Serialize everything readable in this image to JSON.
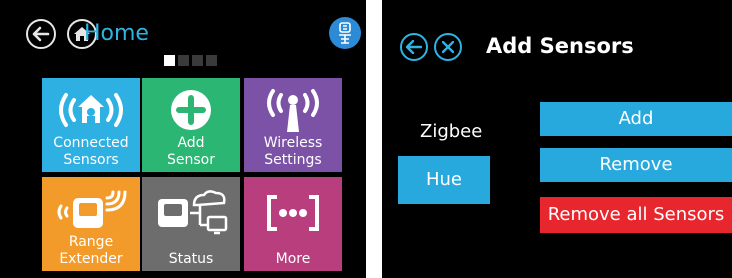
{
  "left": {
    "header": {
      "title": "Home"
    },
    "pager": {
      "pages": 4,
      "current": 1
    },
    "tiles": [
      {
        "line1": "Connected",
        "line2": "Sensors",
        "color": "#2fb0e3",
        "icon": "connected-sensors-icon"
      },
      {
        "line1": "Add",
        "line2": "Sensor",
        "color": "#2bb673",
        "icon": "add-icon"
      },
      {
        "line1": "Wireless",
        "line2": "Settings",
        "color": "#7b52a6",
        "icon": "wireless-icon"
      },
      {
        "line1": "Range",
        "line2": "Extender",
        "color": "#f39b2a",
        "icon": "range-extender-icon"
      },
      {
        "line1": "Status",
        "line2": "",
        "color": "#6d6d6d",
        "icon": "status-icon"
      },
      {
        "line1": "More",
        "line2": "",
        "color": "#b93e7d",
        "icon": "more-icon"
      }
    ]
  },
  "right": {
    "header": {
      "title": "Add Sensors"
    },
    "protocols": {
      "zigbee": "Zigbee",
      "hue": "Hue"
    },
    "actions": {
      "add": "Add",
      "remove": "Remove",
      "remove_all": "Remove all Sensors"
    },
    "colors": {
      "accent": "#28a9de",
      "danger": "#e8262e"
    }
  }
}
